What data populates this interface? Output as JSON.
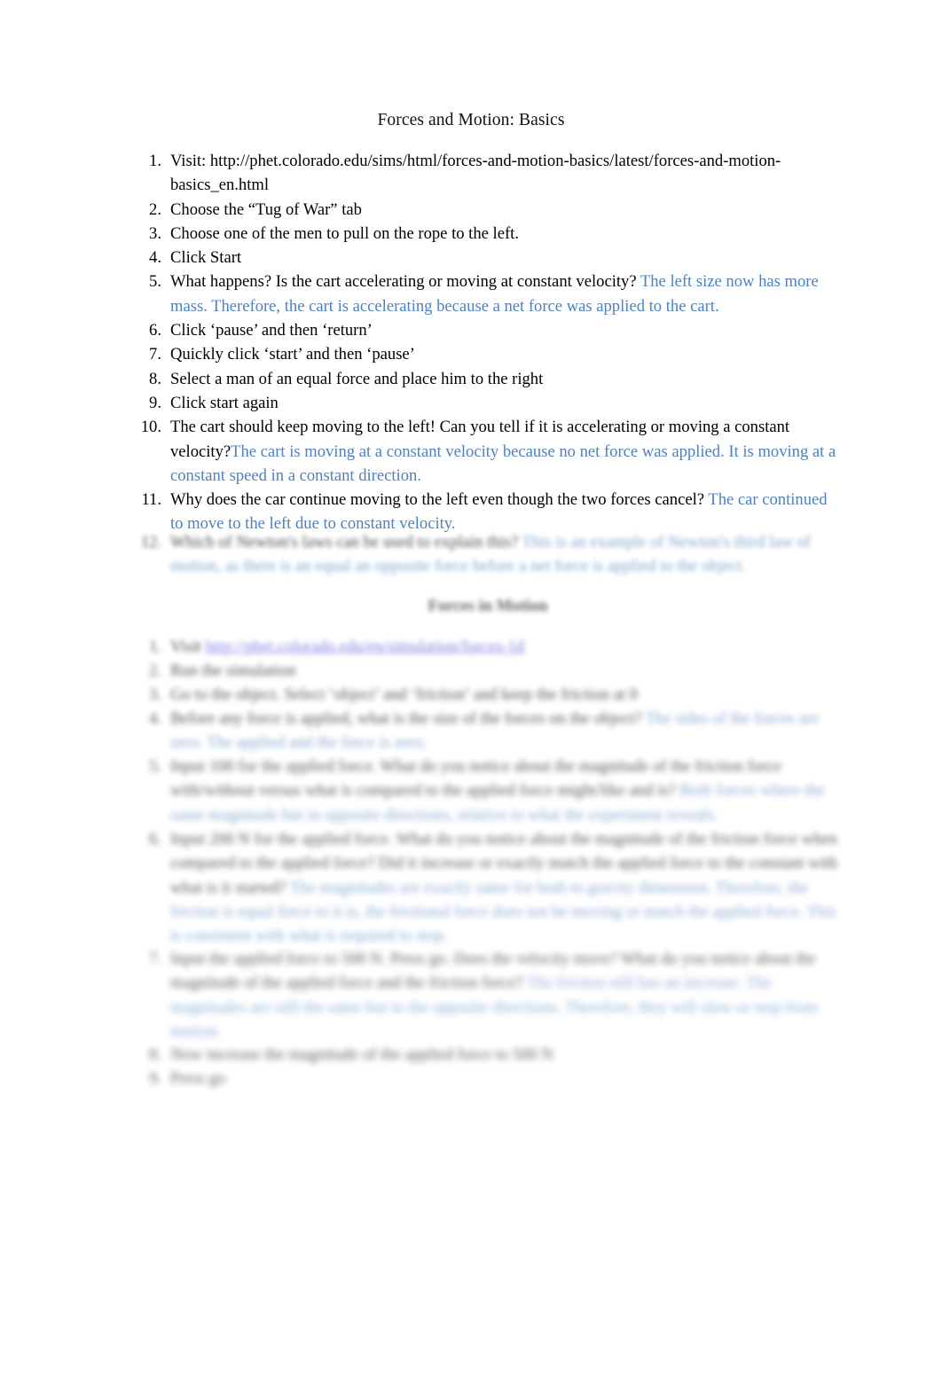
{
  "document": {
    "title": "Forces and Motion: Basics",
    "answer_color": "#4f81bd",
    "link_color": "#4a46d6",
    "background": "#ffffff"
  },
  "list_one": [
    {
      "number": "1.",
      "prompt": "Visit: http://phet.colorado.edu/sims/html/forces-and-motion-basics/latest/forces-and-motion-basics_en.html",
      "answer": ""
    },
    {
      "number": "2.",
      "prompt": "Choose the “Tug of War” tab",
      "answer": ""
    },
    {
      "number": "3.",
      "prompt": "Choose one of the men to pull on the rope to the left.",
      "answer": ""
    },
    {
      "number": "4.",
      "prompt": "Click Start",
      "answer": ""
    },
    {
      "number": "5.",
      "prompt": "What happens?   Is the cart accelerating or moving at constant velocity?  ",
      "answer": "The left size now has more mass. Therefore, the cart is accelerating because a net force was applied to the cart."
    },
    {
      "number": "6.",
      "prompt": "Click ‘pause’ and then ‘return’",
      "answer": ""
    },
    {
      "number": "7.",
      "prompt": "Quickly click ‘start’ and then ‘pause’",
      "answer": ""
    },
    {
      "number": "8.",
      "prompt": "Select a man of an equal force and place him to the right",
      "answer": ""
    },
    {
      "number": "9.",
      "prompt": "Click start again",
      "answer": ""
    },
    {
      "number": "10.",
      "prompt": "The cart should keep moving to the left!   Can you tell if it is accelerating or moving a constant velocity?",
      "answer": "The cart is moving at a constant velocity because no net force was applied. It is moving at a constant speed in a constant direction."
    },
    {
      "number": "11.",
      "prompt": "Why does the car continue moving to the left even though the two forces cancel?    ",
      "answer": "The car continued to move to the left due to constant velocity."
    }
  ],
  "blurred_section": {
    "item_12": {
      "number": "12.",
      "prompt": "Which of Newton's laws can be used to explain this?  ",
      "answer": "This is an example of Newton's third law of motion, as there is an equal an opposite force before a net force is applied to the object."
    },
    "heading": "Forces in Motion",
    "list_two": [
      {
        "number": "1.",
        "prompt": "Visit ",
        "link": "http://phet.colorado.edu/en/simulation/forces-1d",
        "answer": ""
      },
      {
        "number": "2.",
        "prompt": "Run the simulation",
        "answer": ""
      },
      {
        "number": "3.",
        "prompt": "Go to the object.  Select ‘object’ and ‘friction’ and keep the friction at 0",
        "answer": ""
      },
      {
        "number": "4.",
        "prompt": "Before any force is applied, what is the size of the forces on the object?  ",
        "answer": "The sides of the forces are zero. The applied and the force is zero."
      },
      {
        "number": "5.",
        "prompt": "Input 100 for the applied force.   What do you notice about the magnitude of the friction force with/without versus what is compared to the applied force might/like and is?   ",
        "answer": "Both forces where the same magnitude but in opposite directions, relative to what the experiment reveals."
      },
      {
        "number": "6.",
        "prompt": "Input 200 N for the applied force.   What do you notice about the magnitude of the friction force when compared to the applied force?     Did it increase or exactly match the applied force to the constant with what is it started?   ",
        "answer": "The magnitudes are exactly same for both to gravity dimension.  Therefore, the friction is equal force to it is, the frictional force does not be moving or match the applied force.  This is consistent with what is required to stop."
      },
      {
        "number": "7.",
        "prompt": "Input the applied force to 500 N.   Press go.   Does the velocity move?   What do you notice about the magnitude of the applied force and the friction force?    ",
        "answer": "The friction still has an increase.  The magnitudes are still the same but in the opposite directions.  Therefore, they will slow or stop from motion."
      },
      {
        "number": "8.",
        "prompt": "Now increase the magnitude of the applied force to 500 N",
        "answer": ""
      },
      {
        "number": "9.",
        "prompt": "Press go",
        "answer": ""
      }
    ]
  }
}
